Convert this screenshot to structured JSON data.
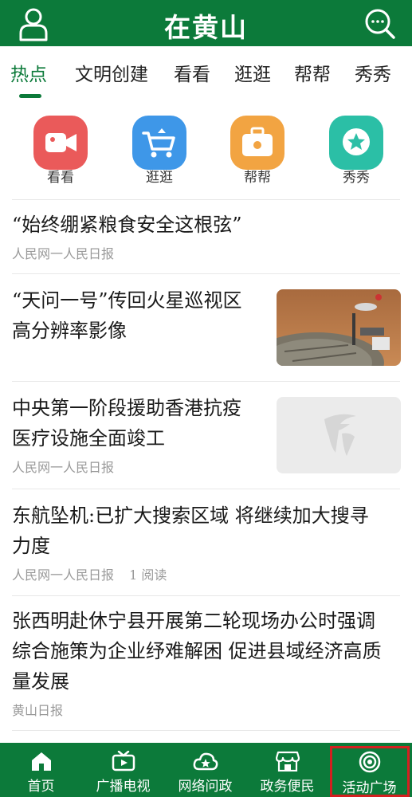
{
  "header": {
    "title": "在黄山"
  },
  "tabs": [
    {
      "label": "热点",
      "active": true
    },
    {
      "label": "文明创建"
    },
    {
      "label": "看看"
    },
    {
      "label": "逛逛"
    },
    {
      "label": "帮帮"
    },
    {
      "label": "秀秀"
    }
  ],
  "quick_links": [
    {
      "label": "看看",
      "icon": "video-camera-icon",
      "color": "#ea5a5a"
    },
    {
      "label": "逛逛",
      "icon": "shopping-cart-icon",
      "color": "#3e97e8"
    },
    {
      "label": "帮帮",
      "icon": "briefcase-icon",
      "color": "#f2a442"
    },
    {
      "label": "秀秀",
      "icon": "star-icon",
      "color": "#2bbfa6"
    }
  ],
  "news": [
    {
      "title": "“始终绷紧粮食安全这根弦”",
      "meta": "人民网一人民日报"
    },
    {
      "title_line1": "“天问一号”传回火星巡视区",
      "title_line2": "高分辨率影像"
    },
    {
      "title_line1": "中央第一阶段援助香港抗疫",
      "title_line2": "医疗设施全面竣工",
      "meta": "人民网一人民日报"
    },
    {
      "title_line1": "东航坠机:已扩大搜索区域  将继续加大搜寻",
      "title_line2": "力度",
      "meta": "人民网一人民日报",
      "reads": "1 阅读"
    },
    {
      "title_line1": "张西明赴休宁县开展第二轮现场办公时强调",
      "title_line2": "综合施策为企业纾难解困 促进县域经济高质",
      "title_line3": "量发展",
      "meta": "黄山日报"
    }
  ],
  "bottom_nav": [
    {
      "label": "首页",
      "icon": "home-icon"
    },
    {
      "label": "广播电视",
      "icon": "tv-icon"
    },
    {
      "label": "网络问政",
      "icon": "cloud-star-icon"
    },
    {
      "label": "政务便民",
      "icon": "store-icon"
    },
    {
      "label": "活动广场",
      "icon": "target-icon"
    }
  ],
  "colors": {
    "brand": "#0c7a3a",
    "highlight": "#d42020"
  }
}
